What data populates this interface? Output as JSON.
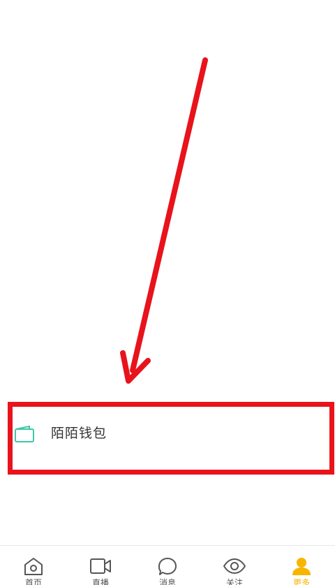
{
  "menu": {
    "wallet_label": "陌陌钱包"
  },
  "tabbar": {
    "items": [
      {
        "label": "首页",
        "icon": "home-icon"
      },
      {
        "label": "直播",
        "icon": "video-icon"
      },
      {
        "label": "消息",
        "icon": "chat-bubble-icon"
      },
      {
        "label": "关注",
        "icon": "eye-icon"
      },
      {
        "label": "更多",
        "icon": "person-icon",
        "active": true
      }
    ],
    "active_color": "#f7b500"
  },
  "annotation": {
    "arrow_color": "#e8131b",
    "box_color": "#e8131b"
  },
  "colors": {
    "wallet_icon": "#3cc8a8"
  }
}
